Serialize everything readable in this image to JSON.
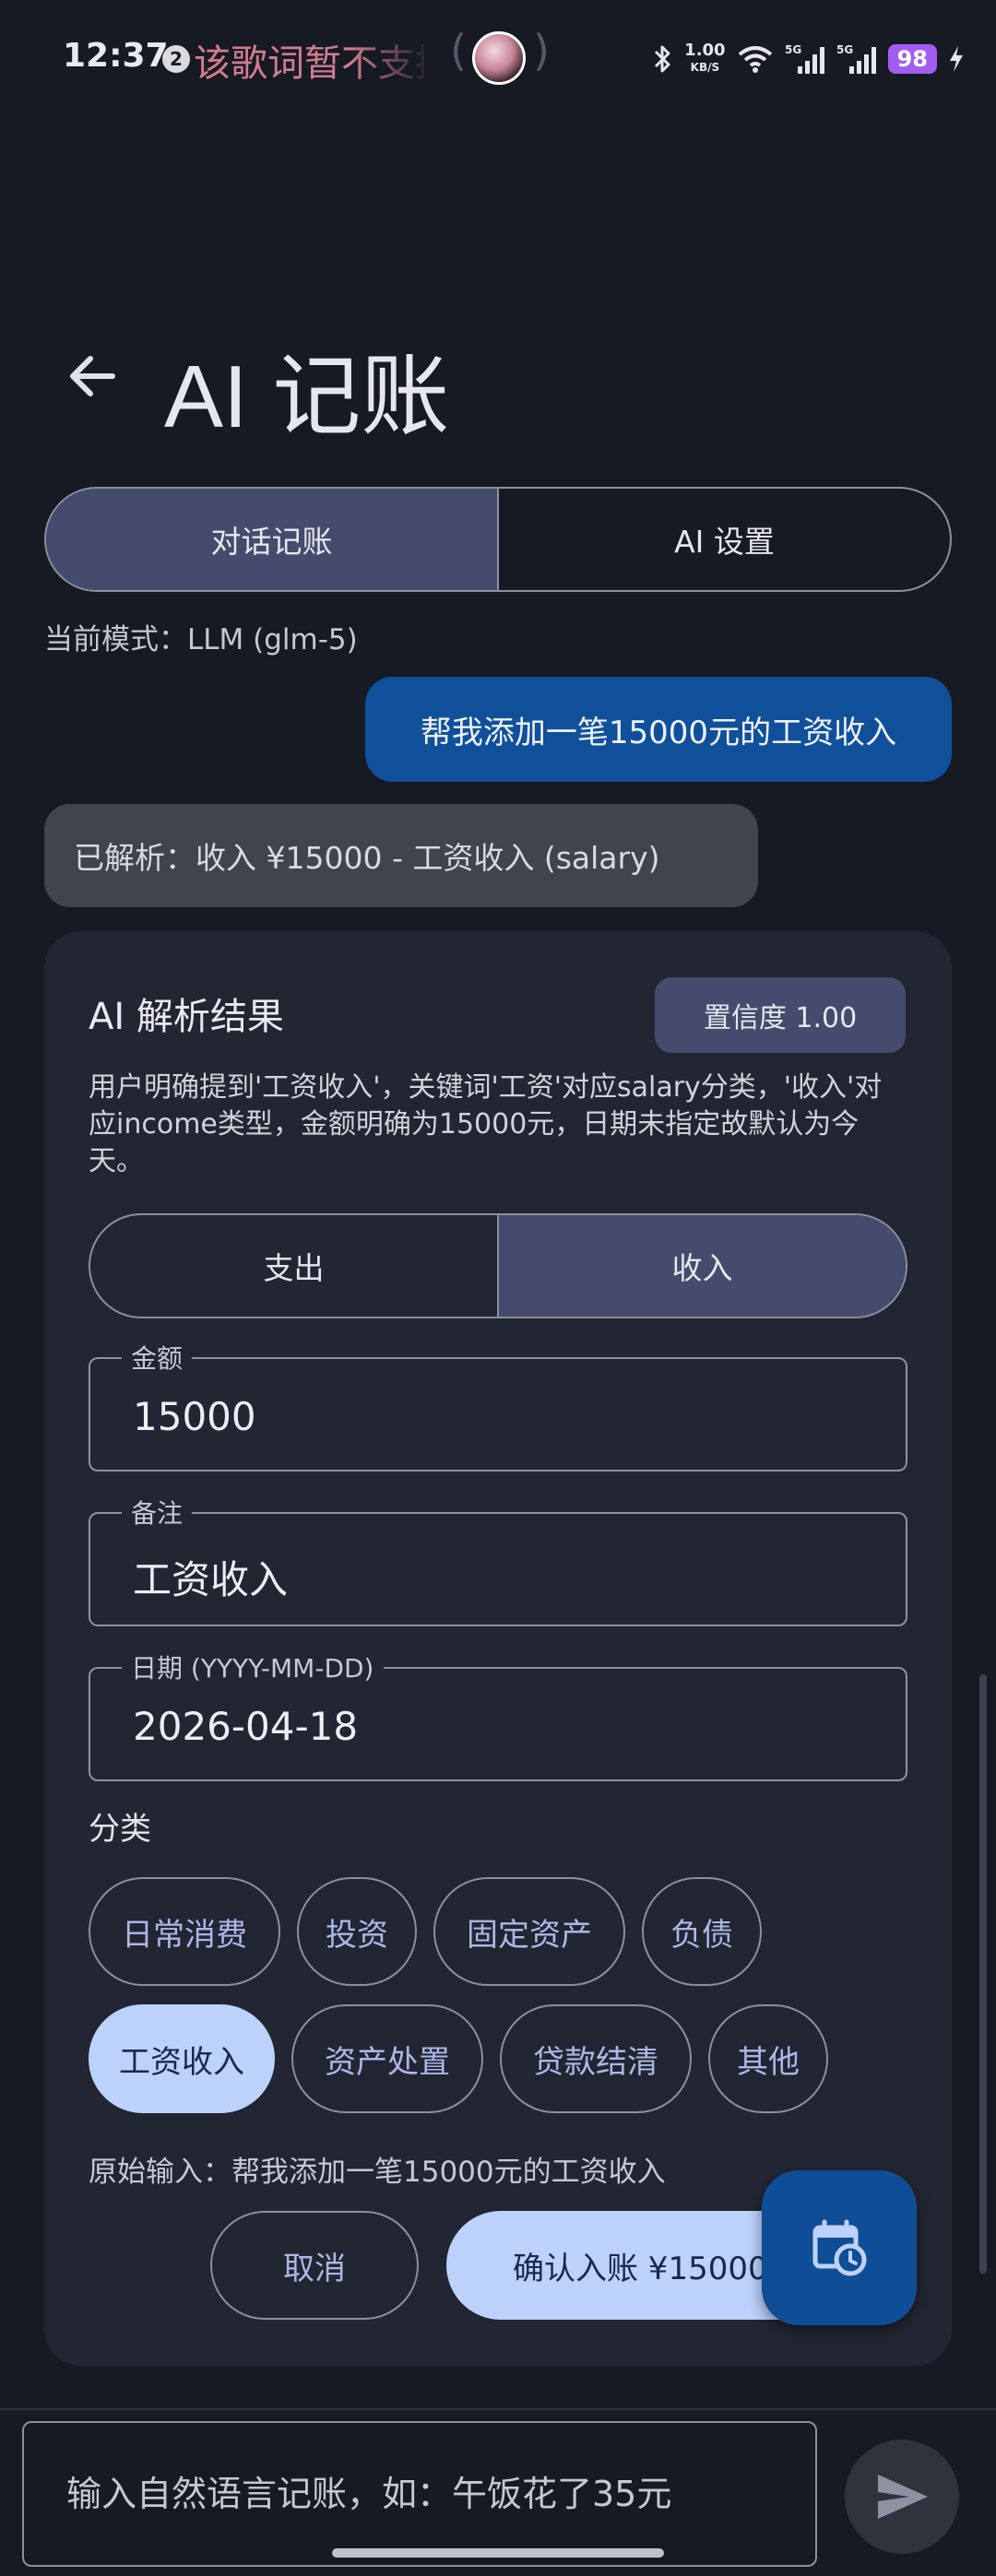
{
  "status_bar": {
    "time": "12:37",
    "notification_count": "2",
    "lyric": "该歌词暂不支持",
    "net_speed": "1.00",
    "net_unit": "KB/S",
    "battery": "98"
  },
  "header": {
    "title": "AI 记账"
  },
  "tabs": [
    {
      "label": "对话记账",
      "active": true
    },
    {
      "label": "AI 设置",
      "active": false
    }
  ],
  "mode_text": "当前模式：LLM (glm-5)",
  "messages": {
    "user": "帮我添加一笔15000元的工资收入",
    "ai": "已解析：收入 ¥15000 - 工资收入 (salary)"
  },
  "result": {
    "title": "AI 解析结果",
    "confidence": "置信度 1.00",
    "reasoning": "用户明确提到'工资收入'，关键词'工资'对应salary分类，'收入'对应income类型，金额明确为15000元，日期未指定故默认为今天。",
    "type_toggle": [
      {
        "label": "支出",
        "active": false
      },
      {
        "label": "收入",
        "active": true
      }
    ],
    "fields": {
      "amount": {
        "label": "金额",
        "value": "15000"
      },
      "note": {
        "label": "备注",
        "value": "工资收入"
      },
      "date": {
        "label": "日期 (YYYY-MM-DD)",
        "value": "2026-04-18"
      }
    },
    "category_title": "分类",
    "categories": [
      {
        "label": "日常消费",
        "selected": false
      },
      {
        "label": "投资",
        "selected": false
      },
      {
        "label": "固定资产",
        "selected": false
      },
      {
        "label": "负债",
        "selected": false
      },
      {
        "label": "工资收入",
        "selected": true
      },
      {
        "label": "资产处置",
        "selected": false
      },
      {
        "label": "贷款结清",
        "selected": false
      },
      {
        "label": "其他",
        "selected": false
      }
    ],
    "raw_input": "原始输入：帮我添加一笔15000元的工资收入",
    "cancel_label": "取消",
    "confirm_label": "确认入账 ¥15000"
  },
  "input": {
    "placeholder": "输入自然语言记账，如：午饭花了35元"
  },
  "colors": {
    "background": "#161a23",
    "card": "#222632",
    "accent": "#bcd2fb",
    "user_bubble": "#10509a",
    "selected_segment": "#454b6c"
  },
  "icons": {
    "back": "back-arrow-icon",
    "fab": "calendar-clock-icon",
    "send": "send-icon"
  }
}
